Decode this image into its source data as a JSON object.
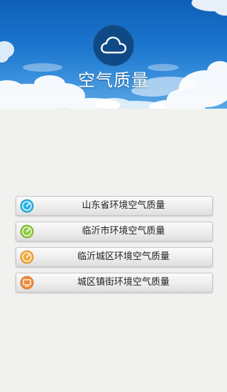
{
  "header": {
    "title": "空气质量",
    "logo_icon": "cloud-icon"
  },
  "menu": {
    "items": [
      {
        "label": "山东省环境空气质量",
        "icon": "gauge-icon",
        "color": "#29b3e8"
      },
      {
        "label": "临沂市环境空气质量",
        "icon": "gauge-icon",
        "color": "#8cc93c"
      },
      {
        "label": "临沂城区环境空气质量",
        "icon": "gauge-icon",
        "color": "#f2a73a"
      },
      {
        "label": "城区镇街环境空气质量",
        "icon": "screen-icon",
        "color": "#f08a3c"
      }
    ]
  }
}
